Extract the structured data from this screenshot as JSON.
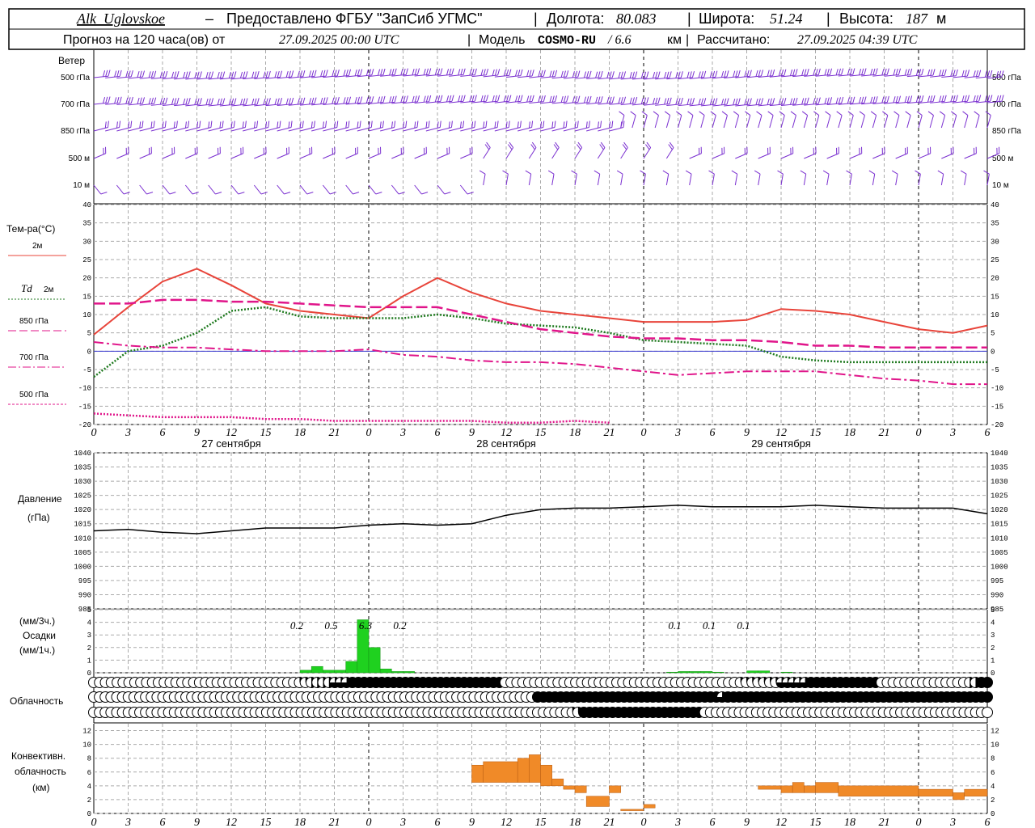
{
  "header": {
    "station": "Alk_Uglovskoe",
    "dash": "–",
    "provider": "Предоставлено ФГБУ \"ЗапСиб УГМС\"",
    "lon_label": "Долгота:",
    "lon": "80.083",
    "lat_label": "Широта:",
    "lat": "51.24",
    "alt_label": "Высота:",
    "alt": "187",
    "alt_unit": "м",
    "forecast_prefix": "Прогноз на 120 часа(ов) от",
    "forecast_time": "27.09.2025 00:00 UTC",
    "model_label": "Модель",
    "model": "COSMO-RU",
    "model_res": "/ 6.6",
    "model_res_unit": "км",
    "calc_label": "Рассчитано:",
    "calc_time": "27.09.2025 04:39 UTC"
  },
  "wind_panel": {
    "title": "Ветер",
    "levels": [
      "500 гПа",
      "700 гПа",
      "850 гПа",
      "500 м",
      "10 м"
    ],
    "color": "#7a2fd0"
  },
  "temp_panel": {
    "title": "Тем-ра(°C)",
    "legend": [
      {
        "label": "2м",
        "color": "#e8443a",
        "style": "solid"
      },
      {
        "label": "Td",
        "label2": "2м",
        "color": "#1f7a1f",
        "style": "dotted"
      },
      {
        "label": "850 гПа",
        "color": "#e0158a",
        "style": "dash"
      },
      {
        "label": "700 гПа",
        "color": "#e0158a",
        "style": "dashdot"
      },
      {
        "label": "500 гПа",
        "color": "#e0158a",
        "style": "dot"
      }
    ],
    "yticks": [
      "40",
      "35",
      "30",
      "25",
      "20",
      "15",
      "10",
      "5",
      "0",
      "-5",
      "-10",
      "-15",
      "-20"
    ]
  },
  "x_axis": {
    "ticks": [
      "0",
      "3",
      "6",
      "9",
      "12",
      "15",
      "18",
      "21",
      "0",
      "3",
      "6",
      "9",
      "12",
      "15",
      "18",
      "21",
      "0",
      "3",
      "6",
      "9",
      "12",
      "15",
      "18",
      "21",
      "0",
      "3",
      "6"
    ],
    "days": [
      "27 сентября",
      "28 сентября",
      "29 сентября"
    ]
  },
  "pressure_panel": {
    "title": "Давление",
    "unit": "(гПа)",
    "yticks": [
      "1040",
      "1035",
      "1030",
      "1025",
      "1020",
      "1015",
      "1010",
      "1005",
      "1000",
      "995",
      "990",
      "985"
    ]
  },
  "precip_panel": {
    "unit3": "(мм/3ч.)",
    "title": "Осадки",
    "unit1": "(мм/1ч.)",
    "yticks": [
      "5",
      "4",
      "3",
      "2",
      "1",
      "0"
    ],
    "totals": [
      {
        "hour": 18,
        "label": "0.2"
      },
      {
        "hour": 21,
        "label": "0.5"
      },
      {
        "hour": 24,
        "label": "6.3"
      },
      {
        "hour": 27,
        "label": "0.2"
      },
      {
        "hour": 51,
        "label": "0.1"
      },
      {
        "hour": 54,
        "label": "0.1"
      },
      {
        "hour": 57,
        "label": "0.1"
      }
    ]
  },
  "cloud_panel": {
    "title": "Облачность"
  },
  "conv_panel": {
    "title1": "Конвективн.",
    "title2": "облачность",
    "unit": "(км)",
    "yticks": [
      "12",
      "10",
      "8",
      "6",
      "4",
      "2",
      "0"
    ]
  },
  "chart_data": {
    "type": "line",
    "x_hours": [
      0,
      3,
      6,
      9,
      12,
      15,
      18,
      21,
      24,
      27,
      30,
      33,
      36,
      39,
      42,
      45,
      48,
      51,
      54,
      57,
      60,
      63,
      66,
      69,
      72,
      75,
      78
    ],
    "temp_2m": [
      4.5,
      12,
      19,
      22.5,
      18,
      13,
      11,
      10,
      9,
      15,
      20,
      16,
      13,
      11,
      10,
      9,
      8,
      8,
      8,
      8.5,
      11.5,
      11,
      10,
      8,
      6,
      5,
      7
    ],
    "td_2m": [
      -7,
      0,
      1.5,
      5,
      11,
      12,
      9.5,
      9,
      9,
      9,
      10,
      9,
      7.5,
      7,
      6.5,
      5,
      3,
      2.5,
      2,
      1.5,
      -1.5,
      -2.5,
      -3,
      -3,
      -3,
      -3,
      -3
    ],
    "t_850": [
      13,
      13,
      14,
      14,
      13.5,
      13.5,
      13,
      12.5,
      12,
      12,
      12,
      10,
      8,
      6,
      5,
      4,
      3.5,
      3.5,
      3,
      3,
      2.5,
      1.5,
      1.5,
      1,
      1,
      1,
      1
    ],
    "t_700": [
      2.5,
      1.5,
      1,
      1,
      0.5,
      0,
      0,
      0,
      0.5,
      -1,
      -1.5,
      -2.5,
      -3,
      -3,
      -3.5,
      -4.5,
      -5.5,
      -6.5,
      -6,
      -5.5,
      -5.5,
      -5.5,
      -6.5,
      -7.5,
      -8,
      -9,
      -9
    ],
    "t_500": [
      -17,
      -17.5,
      -18,
      -18,
      -18,
      -18.5,
      -18.5,
      -19,
      -19,
      -19,
      -19,
      -19,
      -19.5,
      -19.5,
      -19,
      -19.5
    ],
    "t_500_hours": [
      0,
      3,
      6,
      9,
      12,
      15,
      18,
      21,
      24,
      27,
      30,
      33,
      36,
      39,
      42,
      45
    ],
    "pressure": [
      1012.5,
      1013,
      1012,
      1011.5,
      1012.5,
      1013.5,
      1013.5,
      1013.5,
      1014.5,
      1015,
      1014.5,
      1015,
      1018,
      1020,
      1020.5,
      1020.5,
      1021,
      1021.5,
      1021,
      1021,
      1021,
      1021.5,
      1021,
      1020.5,
      1020.5,
      1020.5,
      1018.5
    ],
    "precip_hourly": [
      {
        "h": 19,
        "v": 0.2
      },
      {
        "h": 20,
        "v": 0.5
      },
      {
        "h": 21,
        "v": 0.2
      },
      {
        "h": 22,
        "v": 0.2
      },
      {
        "h": 23,
        "v": 0.9
      },
      {
        "h": 24,
        "v": 4.2
      },
      {
        "h": 25,
        "v": 2
      },
      {
        "h": 26,
        "v": 0.3
      },
      {
        "h": 27,
        "v": 0.1
      },
      {
        "h": 28,
        "v": 0.1
      },
      {
        "h": 51,
        "v": 0.05
      },
      {
        "h": 52,
        "v": 0.1
      },
      {
        "h": 53,
        "v": 0.1
      },
      {
        "h": 54,
        "v": 0.1
      },
      {
        "h": 55,
        "v": 0.05
      },
      {
        "h": 58,
        "v": 0.15
      },
      {
        "h": 59,
        "v": 0.15
      },
      {
        "h": 61,
        "v": 0.05
      }
    ],
    "cloud_rows": {
      "high": "000000000000000000000000000000000001122223334444444444444444444444444400000000000000000000000000000000000000001111111333334444444444440000000000000002244",
      "mid": "000000000000000000000000000000000000000000000000000000000000000000000000000004444444444444444444444444444444434444444444444444444444444444444444444444444444",
      "low": "000000000000000000000000000000000000000000000000000000000000000000000000000000000001144444444444444444444400000000000000000000000000000000000000000000000000"
    },
    "convective": [
      {
        "h0": 33,
        "h1": 34,
        "b": 4.5,
        "t": 7
      },
      {
        "h0": 34,
        "h1": 37,
        "b": 4.5,
        "t": 7.5
      },
      {
        "h0": 37,
        "h1": 38,
        "b": 4.5,
        "t": 8
      },
      {
        "h0": 38,
        "h1": 39,
        "b": 4.5,
        "t": 8.5
      },
      {
        "h0": 39,
        "h1": 40,
        "b": 4,
        "t": 7
      },
      {
        "h0": 40,
        "h1": 41,
        "b": 4,
        "t": 5
      },
      {
        "h0": 41,
        "h1": 42,
        "b": 3.5,
        "t": 4
      },
      {
        "h0": 42,
        "h1": 43,
        "b": 3,
        "t": 4
      },
      {
        "h0": 43,
        "h1": 45,
        "b": 1,
        "t": 2.5
      },
      {
        "h0": 45,
        "h1": 46,
        "b": 3,
        "t": 4
      },
      {
        "h0": 46,
        "h1": 48,
        "b": 0.4,
        "t": 0.6
      },
      {
        "h0": 48,
        "h1": 49,
        "b": 0.8,
        "t": 1.3
      },
      {
        "h0": 58,
        "h1": 60,
        "b": 3.5,
        "t": 4
      },
      {
        "h0": 60,
        "h1": 61,
        "b": 3,
        "t": 4
      },
      {
        "h0": 61,
        "h1": 62,
        "b": 3,
        "t": 4.5
      },
      {
        "h0": 62,
        "h1": 63,
        "b": 3,
        "t": 4
      },
      {
        "h0": 63,
        "h1": 65,
        "b": 3,
        "t": 4.5
      },
      {
        "h0": 65,
        "h1": 72,
        "b": 2.5,
        "t": 4
      },
      {
        "h0": 72,
        "h1": 75,
        "b": 2.5,
        "t": 3.5
      },
      {
        "h0": 75,
        "h1": 76,
        "b": 2,
        "t": 3
      },
      {
        "h0": 76,
        "h1": 78,
        "b": 2.5,
        "t": 3.5
      }
    ]
  }
}
